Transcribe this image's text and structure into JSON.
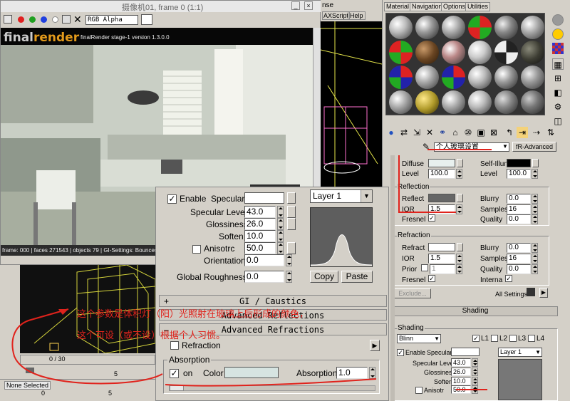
{
  "frame_window": {
    "title": "摄像机01, frame 0 (1:1)",
    "channel": "RGB Alpha",
    "logo_a": "final",
    "logo_b": "render",
    "version": "finalRender stage-1 version 1.3.0.0",
    "status": "frame: 000 | faces 271543 | objects 79 | GI-Settings: Bounces:8"
  },
  "max_menu": {
    "script": "AXScript",
    "help": "Help",
    "nse": "nse"
  },
  "timeline": {
    "frame": "0 / 30",
    "none_selected": "None Selected",
    "tick5": "5",
    "tick0": "0",
    "tick5b": "5"
  },
  "mat_menu": [
    "Material",
    "Navigation",
    "Options",
    "Utilities"
  ],
  "material": {
    "name": "个人玻璃设置",
    "type": "fR-Advanced"
  },
  "main": {
    "enable": "Enable",
    "specular": "Specular",
    "specular_level_label": "Specular Level",
    "specular_level": "43.0",
    "glossiness_label": "Glossiness",
    "glossiness": "26.0",
    "soften_label": "Soften",
    "soften": "10.0",
    "aniso_label": "Anisotrc",
    "aniso": "50.0",
    "orientation_label": "Orientation",
    "orientation": "0.0",
    "global_rough_label": "Global Roughness",
    "global_rough": "0.0",
    "layer": "Layer 1",
    "copy": "Copy",
    "paste": "Paste",
    "gi_caustics": "GI / Caustics",
    "adv_refl_partial": "Advanced Reflections",
    "adv_refr": "Advanced Refractions",
    "refraction": "Refraction",
    "absorption_group": "Absorption",
    "on": "on",
    "color": "Color",
    "absorption_label": "Absorption",
    "absorption": "1.0",
    "absorption_color": "#d6e4e1"
  },
  "right_panel": {
    "diffuse": "Diffuse",
    "self_illum": "Self-Illum.",
    "level": "Level",
    "level_val": "100.0",
    "level2": "Level",
    "level2_val": "100.0",
    "reflection": "Reflection",
    "reflect": "Reflect",
    "blurry": "Blurry",
    "blurry_val": "0.0",
    "ior": "IOR",
    "ior_val": "1.5",
    "samples": "Samples",
    "samples_val": "16",
    "fresnel": "Fresnel",
    "quality": "Quality",
    "quality_val": "0.0",
    "refraction": "Refraction",
    "refract": "Refract",
    "blurry2": "Blurry",
    "blurry2_val": "0.0",
    "ior2": "IOR",
    "ior2_val": "1.5",
    "samples2": "Samples",
    "samples2_val": "16",
    "prior": "Prior",
    "prior_val": "1",
    "quality2": "Quality",
    "quality2_val": "0.0",
    "fresnel2": "Fresnel",
    "interna": "Interna",
    "exclude": "Exclude...",
    "all_settings": "All Settings",
    "shading_bar": "Shading",
    "shading_group": "Shading",
    "shader": "Blinn",
    "l1": "L1",
    "l2": "L2",
    "l3": "L3",
    "l4": "L4",
    "enable": "Enable",
    "specular": "Specular",
    "layer": "Layer 1",
    "spec_level_label": "Specular Level",
    "spec_level": "43.0",
    "gloss_label": "Glossiness",
    "gloss": "26.0",
    "soften_label": "Soften",
    "soften": "10.0",
    "aniso_label": "Anisotr",
    "aniso": "50.0"
  },
  "annotation": {
    "line1": "这个参数是体积灯（阳）光照射在玻璃上后形成的颜色，",
    "line2": "这个可设（或不设）根据个人习惯。"
  }
}
